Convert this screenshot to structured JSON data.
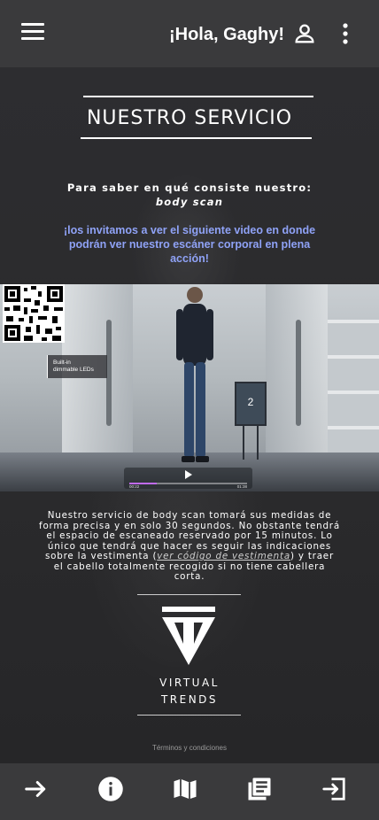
{
  "header": {
    "greeting": "¡Hola, Gaghy!",
    "icons": [
      "menu-icon",
      "user-icon",
      "more-vert-icon"
    ]
  },
  "section": {
    "title": "NUESTRO SERVICIO",
    "intro_lead": "Para saber en qué consiste nuestro:",
    "intro_emphasis": "body scan",
    "invite": "¡los invitamos a ver el siguiente video en donde podrán ver nuestro escáner corporal en plena acción!"
  },
  "video": {
    "overlay_label_line1": "Built-in",
    "overlay_label_line2": "dimmable LEDs",
    "monitor_number": "2",
    "time_current": "00:22",
    "time_total": "01:38",
    "progress": 0.23
  },
  "description": {
    "text_before": "Nuestro servicio de body scan tomará sus medidas de forma precisa y en solo 30 segundos. No obstante tendrá el espacio de escaneado reservado por 15 minutos. Lo único que tendrá que hacer es seguir las indicaciones sobre la vestimenta (",
    "link_text": "ver código de vestimenta",
    "text_after": ")  y traer el cabello totalmente recogido si no tiene cabellera corta."
  },
  "brand": {
    "line1": "VIRTUAL",
    "line2": "TRENDS"
  },
  "footer": {
    "terms": "Términos y condiciones"
  },
  "bottom_nav": {
    "icons": [
      "arrow-right-icon",
      "info-icon",
      "map-icon",
      "library-books-icon",
      "exit-icon"
    ]
  },
  "colors": {
    "background": "#2b2b2d",
    "bar": "#3a3a3c",
    "accent_text": "#8fa2f6"
  }
}
